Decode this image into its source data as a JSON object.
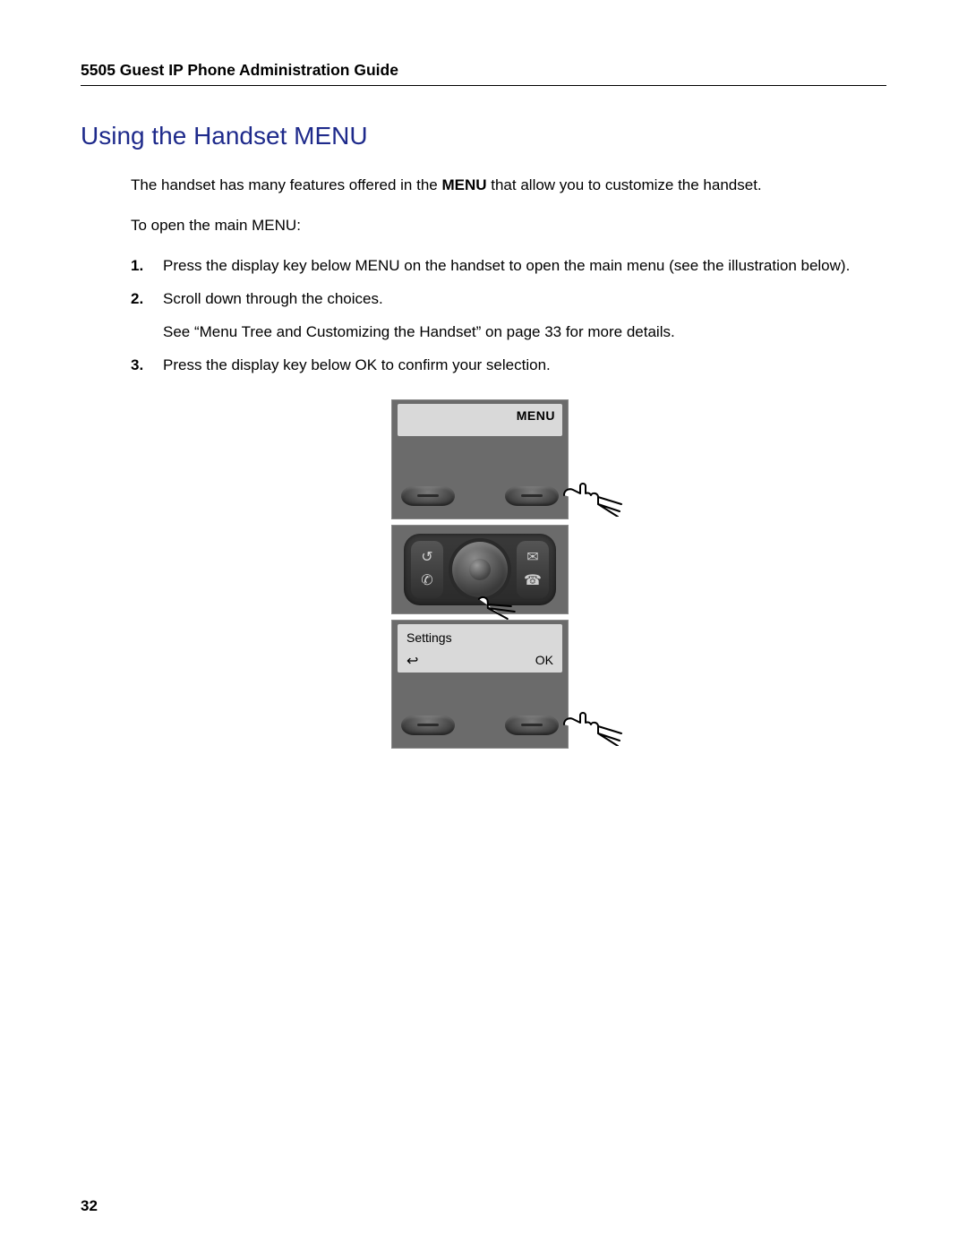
{
  "header": {
    "running_title": "5505 Guest IP Phone Administration Guide"
  },
  "section": {
    "title": "Using the Handset MENU"
  },
  "content": {
    "intro_pre": "The handset has many features offered in the ",
    "intro_bold": "MENU",
    "intro_post": " that allow you to customize the handset.",
    "open_line": "To open the main MENU:",
    "steps": [
      {
        "text": "Press the display key below MENU on the handset to open the main menu (see the illustration below)."
      },
      {
        "text": "Scroll down through the choices.",
        "sub": "See “Menu Tree and Customizing the Handset” on page 33 for more details."
      },
      {
        "text": "Press the display key below OK to confirm your selection."
      }
    ]
  },
  "illustration": {
    "panel1": {
      "screen_label": "MENU"
    },
    "panel3": {
      "title": "Settings",
      "back_glyph": "↩",
      "ok_label": "OK"
    }
  },
  "footer": {
    "page_number": "32"
  }
}
